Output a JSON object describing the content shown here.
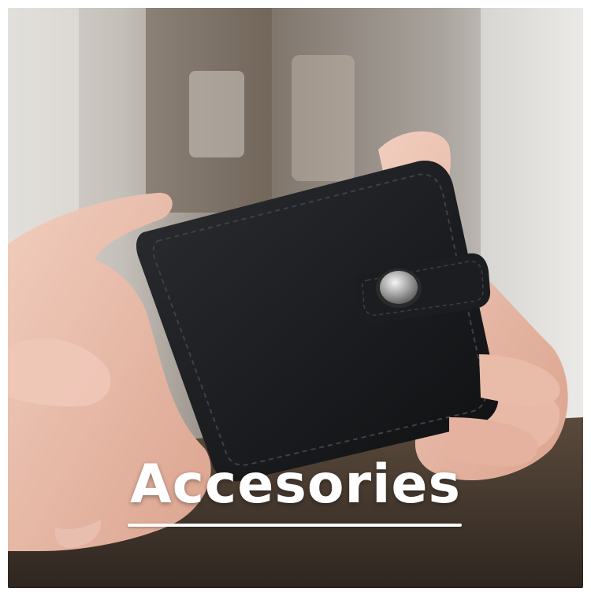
{
  "category": {
    "title": "Accesories"
  },
  "image": {
    "subject": "wallet-photo"
  }
}
